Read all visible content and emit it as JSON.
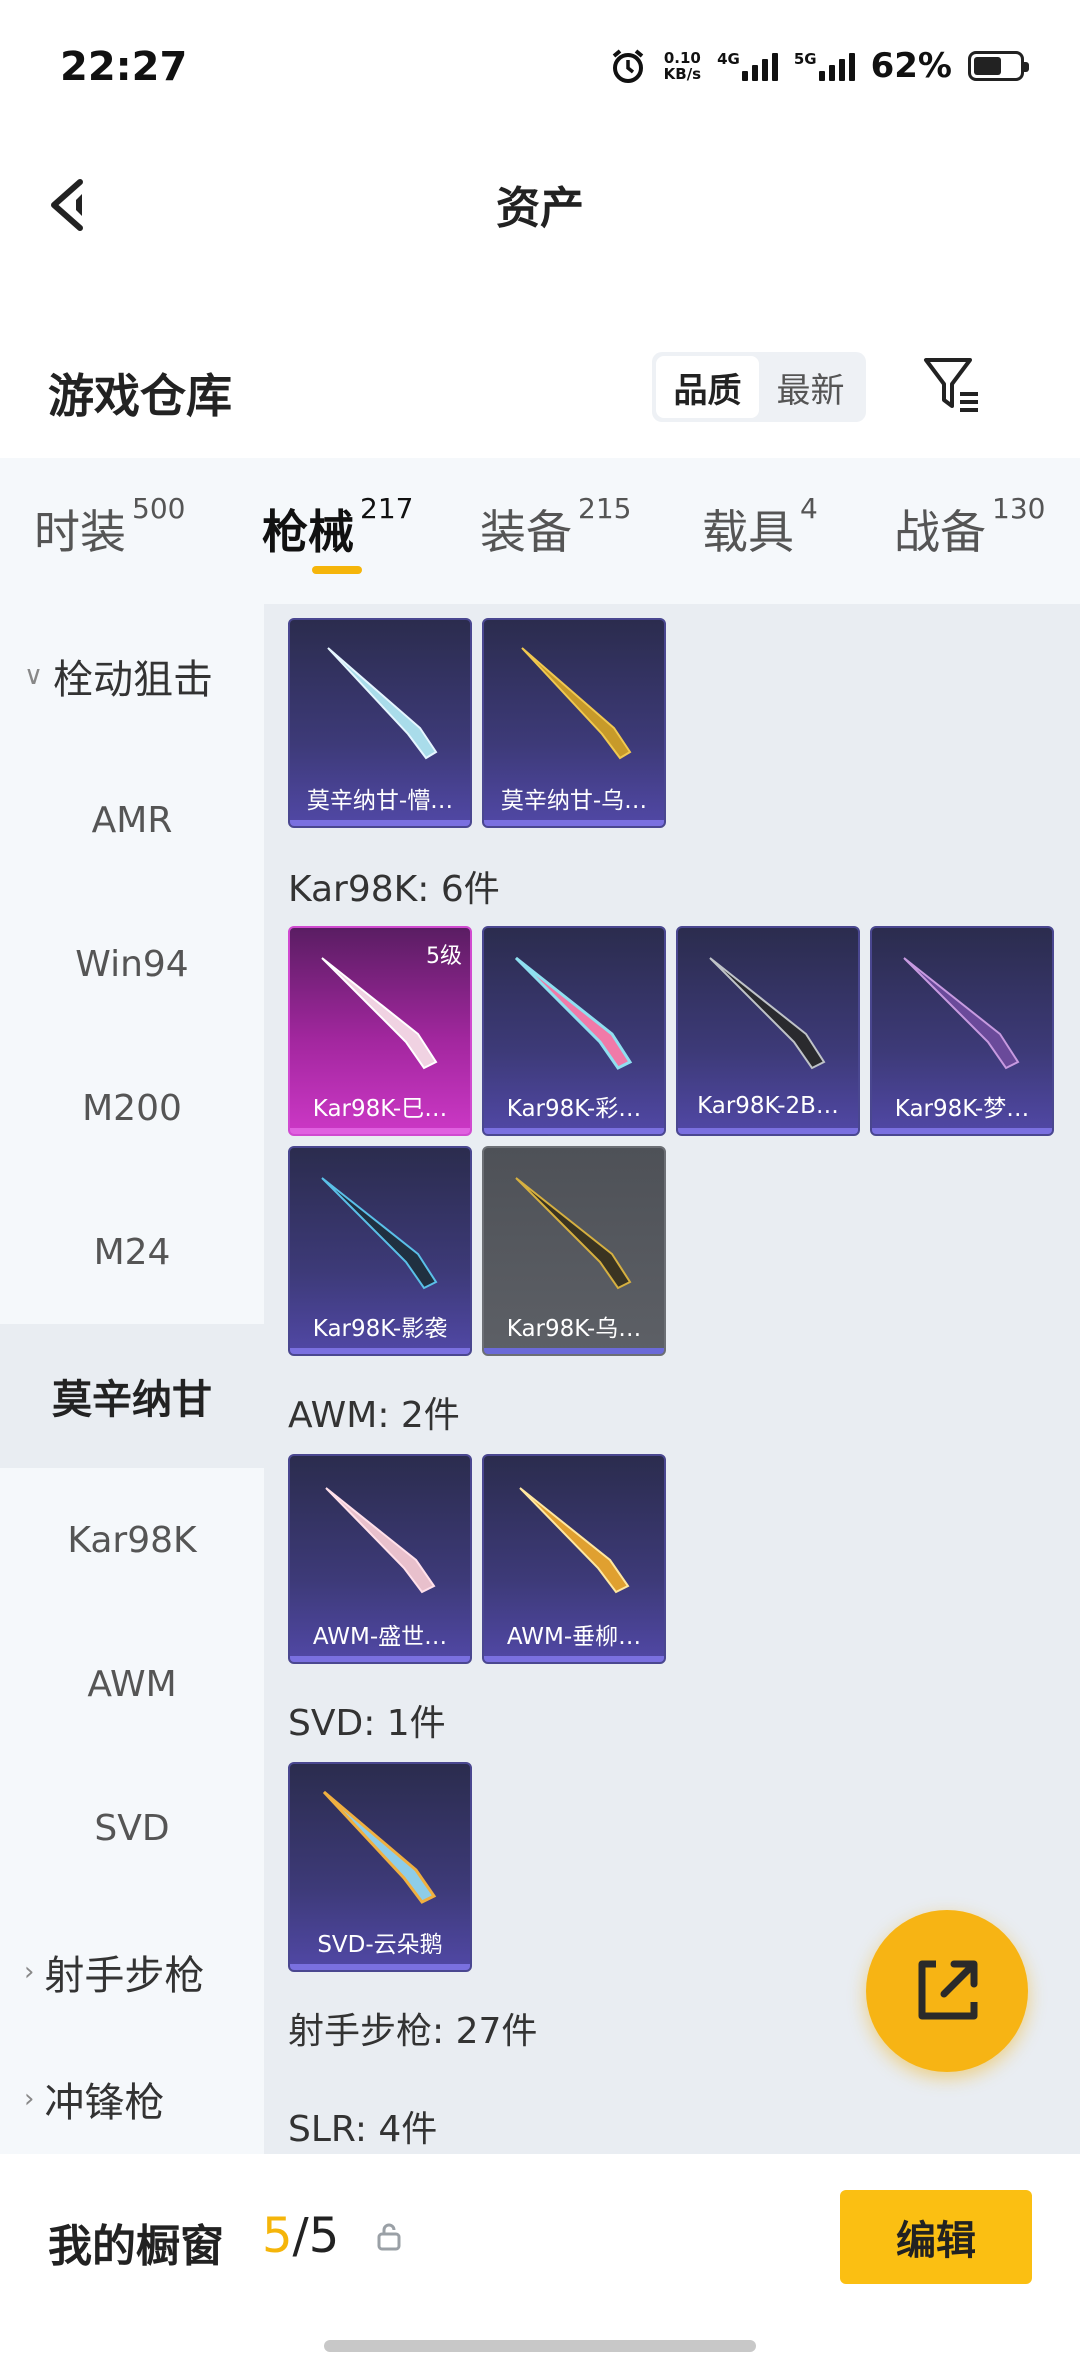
{
  "status_bar": {
    "time": "22:27",
    "net_speed_top": "0.10",
    "net_speed_bottom": "KB/s",
    "sim1": "4G",
    "sim2": "5G",
    "battery": "62%",
    "battery_level": 0.62
  },
  "header": {
    "title": "资产"
  },
  "warehouse": {
    "title": "游戏仓库",
    "sort_options": [
      "品质",
      "最新"
    ],
    "selected_sort": "品质"
  },
  "tabs": [
    {
      "label": "时装",
      "count": "500"
    },
    {
      "label": "枪械",
      "count": "217",
      "active": true
    },
    {
      "label": "装备",
      "count": "215"
    },
    {
      "label": "载具",
      "count": "4"
    },
    {
      "label": "战备",
      "count": "130"
    }
  ],
  "sidebar": [
    {
      "label": "栓动狙击",
      "type": "group",
      "expanded": true
    },
    {
      "label": "AMR"
    },
    {
      "label": "Win94"
    },
    {
      "label": "M200"
    },
    {
      "label": "M24"
    },
    {
      "label": "莫辛纳甘",
      "selected": true
    },
    {
      "label": "Kar98K"
    },
    {
      "label": "AWM"
    },
    {
      "label": "SVD"
    },
    {
      "label": "射手步枪",
      "type": "group",
      "expanded": false
    },
    {
      "label": "冲锋枪",
      "type": "group",
      "expanded": false
    }
  ],
  "sections": [
    {
      "label": "",
      "items": [
        {
          "name": "莫辛纳甘-懵…",
          "style": "purple"
        },
        {
          "name": "莫辛纳甘-乌…",
          "style": "purple"
        }
      ]
    },
    {
      "label": "Kar98K: 6件",
      "items": [
        {
          "name": "Kar98K-巳…",
          "style": "pink",
          "badge": "5级"
        },
        {
          "name": "Kar98K-彩…",
          "style": "purple"
        },
        {
          "name": "Kar98K-2B…",
          "style": "purple"
        },
        {
          "name": "Kar98K-梦…",
          "style": "purple"
        },
        {
          "name": "Kar98K-影袭",
          "style": "purple"
        },
        {
          "name": "Kar98K-乌…",
          "style": "gray"
        }
      ]
    },
    {
      "label": "AWM: 2件",
      "items": [
        {
          "name": "AWM-盛世…",
          "style": "purple"
        },
        {
          "name": "AWM-垂柳…",
          "style": "purple"
        }
      ]
    },
    {
      "label": "SVD: 1件",
      "items": [
        {
          "name": "SVD-云朵鹅",
          "style": "purple"
        }
      ]
    },
    {
      "label": "射手步枪: 27件",
      "items": []
    },
    {
      "label": "SLR: 4件",
      "items": []
    }
  ],
  "showcase": {
    "title": "我的橱窗",
    "count_current": "5",
    "count_sep": "/",
    "count_total": "5",
    "edit_label": "编辑"
  },
  "colors": {
    "accent": "#f5b50a",
    "button": "#fbbf12",
    "card_purple": "#3d3a78",
    "card_pink": "#a3279f",
    "card_gray": "#5d6066"
  },
  "icons": [
    "alarm-icon",
    "back-icon",
    "filter-icon",
    "share-icon",
    "lock-icon",
    "chevron-down-icon",
    "chevron-right-icon"
  ]
}
